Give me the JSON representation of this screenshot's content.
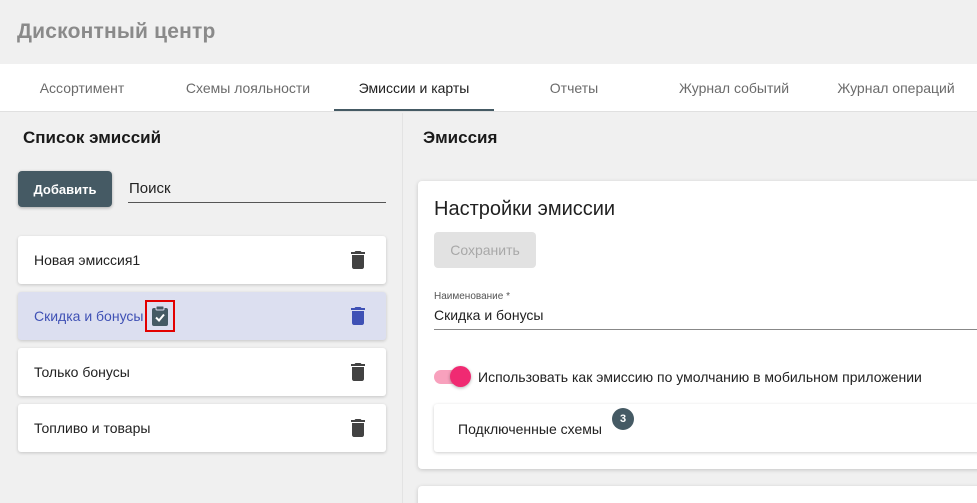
{
  "app": {
    "title": "Дисконтный центр"
  },
  "tabs": [
    {
      "label": "Ассортимент",
      "active": false
    },
    {
      "label": "Схемы лояльности",
      "active": false
    },
    {
      "label": "Эмиссии и карты",
      "active": true
    },
    {
      "label": "Отчеты",
      "active": false
    },
    {
      "label": "Журнал событий",
      "active": false
    },
    {
      "label": "Журнал операций",
      "active": false
    }
  ],
  "left": {
    "title": "Список эмиссий",
    "add_label": "Добавить",
    "search_placeholder": "Поиск",
    "items": [
      {
        "label": "Новая эмиссия1",
        "selected": false
      },
      {
        "label": "Скидка и бонусы",
        "selected": true,
        "default_icon": "clipboard-check-icon"
      },
      {
        "label": "Только бонусы",
        "selected": false
      },
      {
        "label": "Топливо и товары",
        "selected": false
      }
    ]
  },
  "right": {
    "title": "Эмиссия",
    "settings_title": "Настройки эмиссии",
    "save_label": "Сохранить",
    "name_label": "Наименование *",
    "name_value": "Скидка и бонусы",
    "default_toggle_label": "Использовать как эмиссию по умолчанию в мобильном приложении",
    "default_toggle_on": true,
    "schemes_label": "Подключенные схемы",
    "schemes_count": "3"
  },
  "colors": {
    "primary_dark": "#455a64",
    "selected_item_bg": "#dcdff0",
    "selected_item_text": "#3f51b5",
    "toggle_accent": "#f02a72",
    "highlight_box": "#e30000"
  }
}
